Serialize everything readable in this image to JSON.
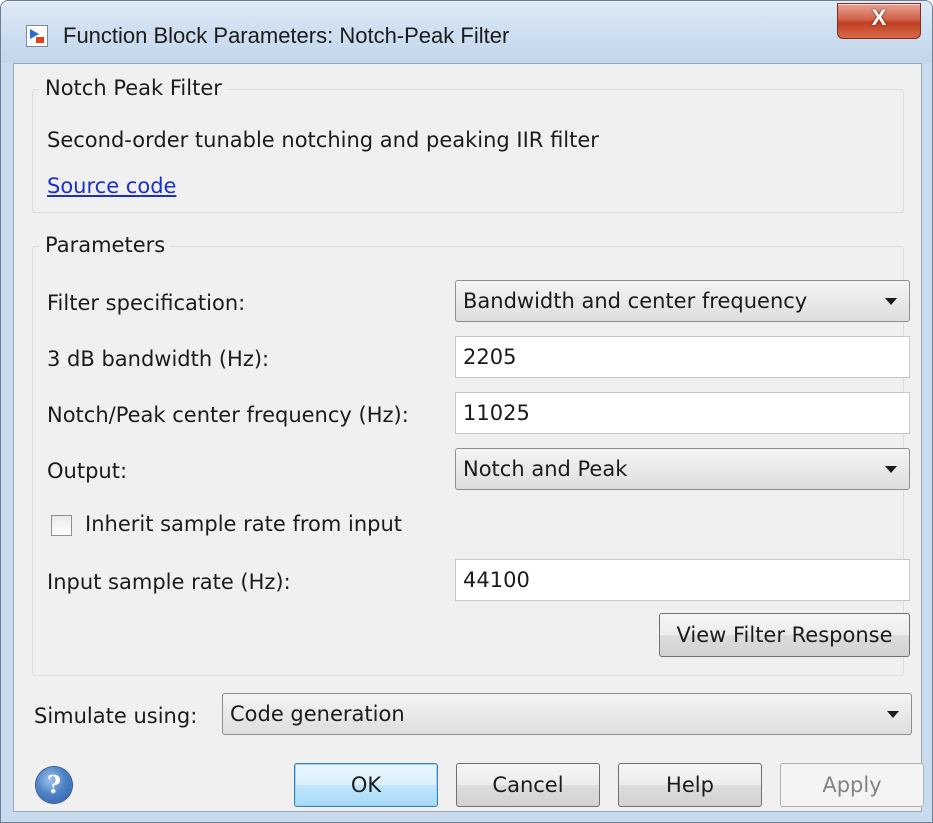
{
  "window": {
    "title": "Function Block Parameters: Notch-Peak Filter",
    "app_icon": "simulink-block-icon",
    "close_label": "X"
  },
  "block_group": {
    "title": "Notch Peak Filter",
    "description": "Second-order tunable notching and peaking IIR filter",
    "link_label": "Source code"
  },
  "parameters": {
    "title": "Parameters",
    "filter_spec_label": "Filter specification:",
    "filter_spec_value": "Bandwidth and center frequency",
    "bandwidth_label": "3 dB bandwidth (Hz):",
    "bandwidth_value": "2205",
    "center_freq_label": "Notch/Peak center frequency (Hz):",
    "center_freq_value": "11025",
    "output_label": "Output:",
    "output_value": "Notch and Peak",
    "inherit_label": "Inherit sample rate from input",
    "inherit_checked": false,
    "sample_rate_label": "Input sample rate (Hz):",
    "sample_rate_value": "44100",
    "view_response_label": "View Filter Response"
  },
  "simulate": {
    "label": "Simulate using:",
    "value": "Code generation"
  },
  "footer": {
    "help_icon": "question-mark",
    "ok_label": "OK",
    "cancel_label": "Cancel",
    "help_label": "Help",
    "apply_label": "Apply"
  },
  "colors": {
    "titlebar": "#cfe0f1",
    "close_button": "#c13f22",
    "link": "#1a31c9",
    "dialog_background": "#f0f0f0",
    "default_button_border": "#3c7fb1"
  }
}
